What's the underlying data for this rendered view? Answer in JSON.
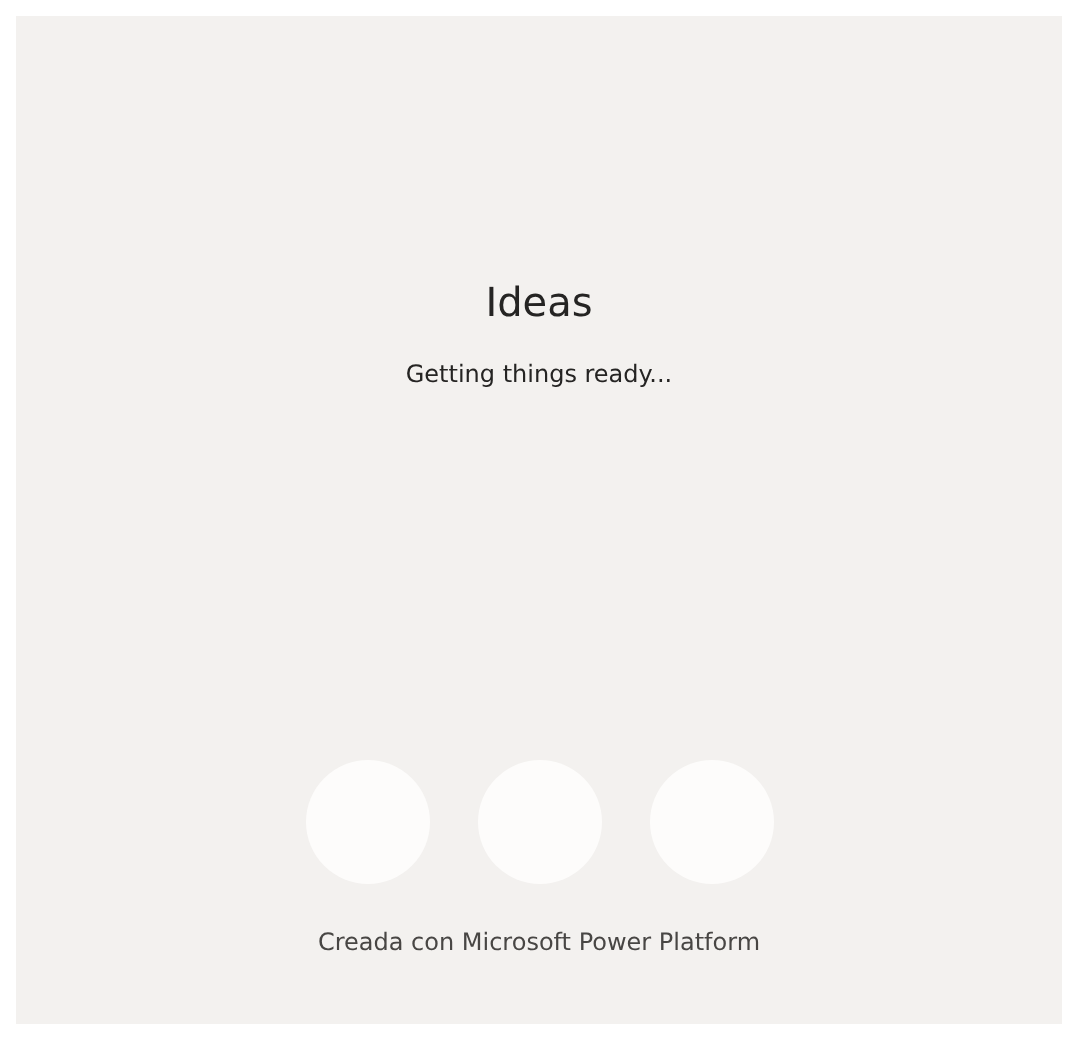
{
  "title": "Ideas",
  "status": "Getting things ready...",
  "footer": "Creada con Microsoft Power Platform"
}
